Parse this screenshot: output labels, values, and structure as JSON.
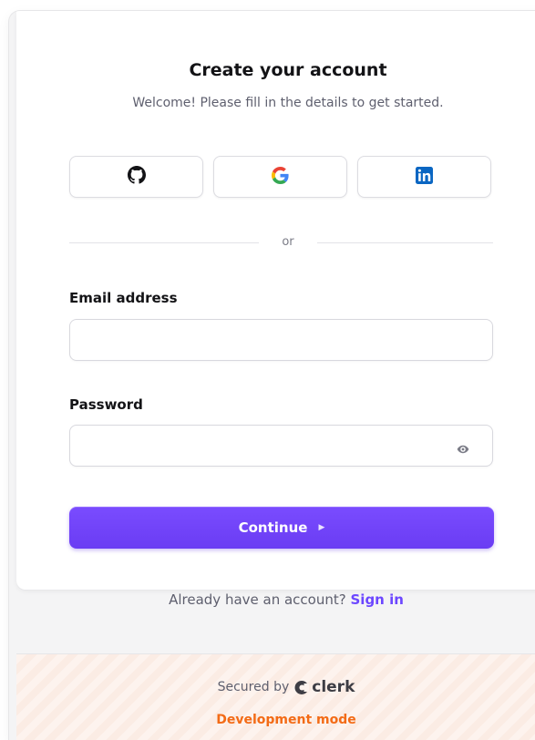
{
  "header": {
    "title": "Create your account",
    "subtitle": "Welcome! Please fill in the details to get started."
  },
  "social_buttons": [
    {
      "provider": "GitHub",
      "icon": "github-icon"
    },
    {
      "provider": "Google",
      "icon": "google-icon"
    },
    {
      "provider": "LinkedIn",
      "icon": "linkedin-icon"
    }
  ],
  "divider": {
    "text": "or"
  },
  "form": {
    "email_label": "Email address",
    "email_value": "",
    "email_placeholder": "",
    "password_label": "Password",
    "password_value": "",
    "password_placeholder": "",
    "password_toggle_icon": "eye-icon",
    "continue_label": "Continue",
    "continue_icon": "triangle-right-icon"
  },
  "signin": {
    "prompt": "Already have an account?",
    "link": "Sign in"
  },
  "footer": {
    "secured_by": "Secured by",
    "brand": "clerk",
    "mode": "Development mode"
  },
  "colors": {
    "accent": "#6c47ff",
    "dev_mode": "#f36b16",
    "linkedin": "#0a66c2"
  }
}
